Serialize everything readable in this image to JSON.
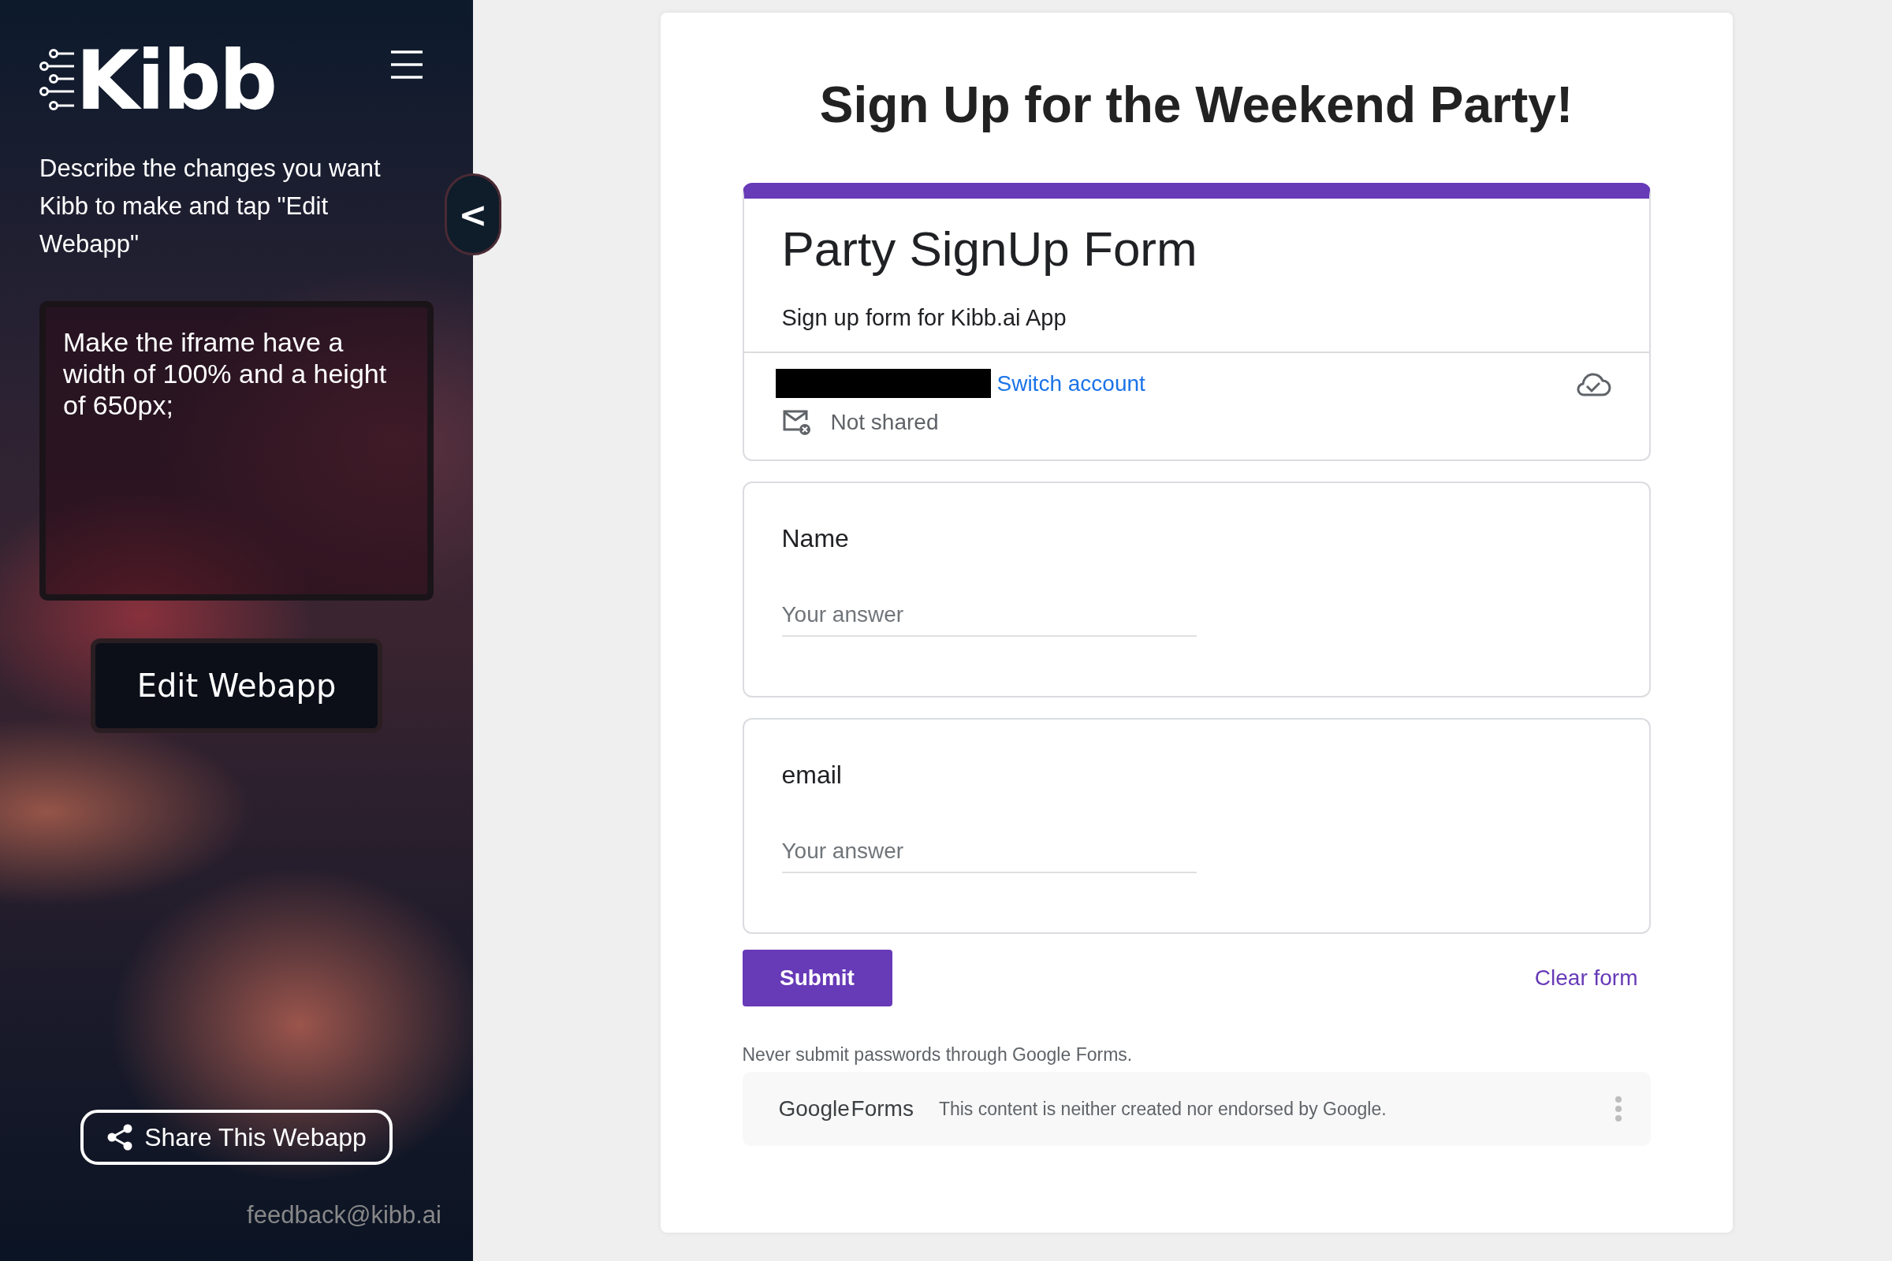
{
  "sidebar": {
    "logo": "Kibb",
    "instructions": "Describe the changes you want Kibb to make and tap \"Edit Webapp\"",
    "prompt": {
      "value": "Make the iframe have a width of 100% and a height of 650px;"
    },
    "edit_button": "Edit Webapp",
    "collapse_button": "<",
    "share_button": "Share This Webapp",
    "feedback": "feedback@kibb.ai"
  },
  "page": {
    "title": "Sign Up for the Weekend Party!",
    "form": {
      "title": "Party SignUp Form",
      "description": "Sign up form for Kibb.ai App",
      "switch_account": "Switch account",
      "sharing": "Not shared",
      "questions": [
        {
          "label": "Name",
          "placeholder": "Your answer"
        },
        {
          "label": "email",
          "placeholder": "Your answer"
        }
      ],
      "submit": "Submit",
      "clear": "Clear form",
      "notice": "Never submit passwords through Google Forms.",
      "brand": "Google Forms",
      "disclaimer": "This content is neither created nor endorsed by Google."
    }
  }
}
